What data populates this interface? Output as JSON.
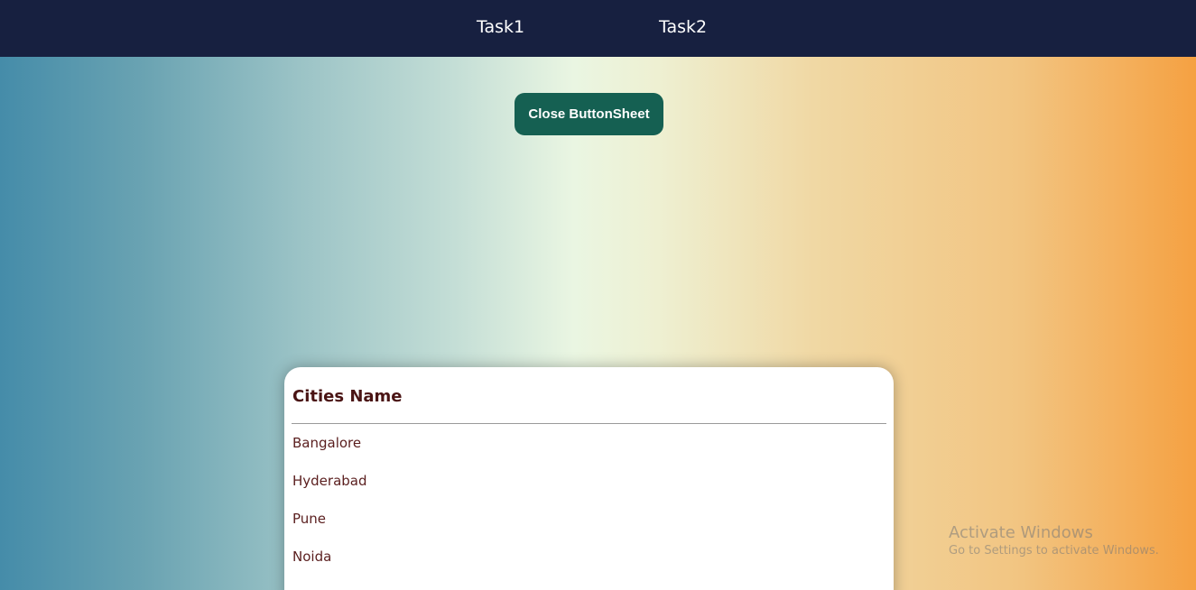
{
  "nav": {
    "items": [
      {
        "label": "Task1"
      },
      {
        "label": "Task2"
      }
    ]
  },
  "actions": {
    "close_label": "Close ButtonSheet"
  },
  "sheet": {
    "title": "Cities Name",
    "cities": [
      "Bangalore",
      "Hyderabad",
      "Pune",
      "Noida"
    ]
  },
  "watermark": {
    "title": "Activate Windows",
    "subtitle": "Go to Settings to activate Windows."
  }
}
